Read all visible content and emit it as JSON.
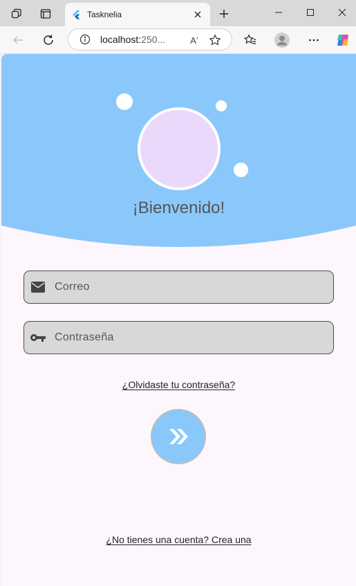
{
  "browser": {
    "tab_title": "Tasknelia",
    "url_host": "localhost:",
    "url_rest": "250...",
    "read_aloud_label": "Aʼ"
  },
  "app": {
    "welcome": "¡Bienvenido!",
    "email_placeholder": "Correo",
    "password_placeholder": "Contraseña",
    "forgot_password": "¿Olvidaste tu contraseña?",
    "signup_prompt": "¿No tienes una cuenta? Crea una",
    "colors": {
      "hero": "#8ac8fb",
      "background": "#fdf6fd",
      "avatar": "#ead9fb",
      "field": "#d8d8d8"
    },
    "icons": {
      "email": "mail-icon",
      "password": "key-icon",
      "submit": "double-chevron-right-icon"
    }
  }
}
